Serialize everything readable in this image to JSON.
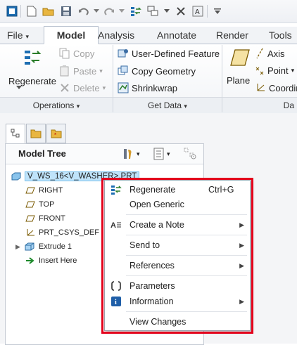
{
  "ribbon_tabs": [
    "File",
    "Model",
    "Analysis",
    "Annotate",
    "Render",
    "Tools"
  ],
  "active_tab": "Model",
  "operations": {
    "regenerate": "Regenerate",
    "copy": "Copy",
    "paste": "Paste",
    "delete": "Delete",
    "group_label": "Operations"
  },
  "get_data": {
    "udf": "User-Defined Feature",
    "copy_geometry": "Copy Geometry",
    "shrinkwrap": "Shrinkwrap",
    "group_label": "Get Data"
  },
  "datum": {
    "plane": "Plane",
    "axis": "Axis",
    "point": "Point",
    "coord": "Coordin",
    "group_label_partial": "Da"
  },
  "model_tree": {
    "title": "Model Tree",
    "root": "V_WS_16<V_WASHER>.PRT",
    "items": [
      "RIGHT",
      "TOP",
      "FRONT",
      "PRT_CSYS_DEF",
      "Extrude 1",
      "Insert Here"
    ]
  },
  "context_menu": {
    "regenerate": "Regenerate",
    "regenerate_shortcut": "Ctrl+G",
    "open_generic": "Open Generic",
    "create_note": "Create a Note",
    "send_to": "Send to",
    "references": "References",
    "parameters": "Parameters",
    "information": "Information",
    "view_changes": "View Changes"
  },
  "colors": {
    "accent_tab": "#ffffff",
    "highlight_box": "#e3001b",
    "selection": "#bfe3fa"
  }
}
